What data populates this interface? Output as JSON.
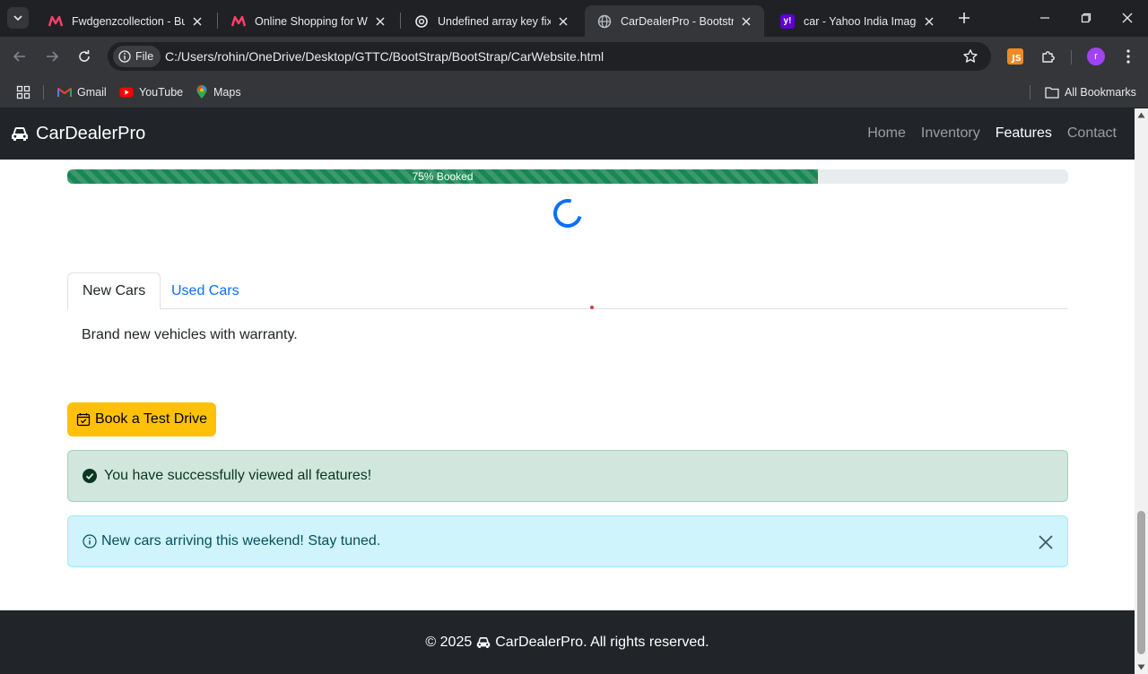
{
  "browser": {
    "tabs": [
      {
        "title": "Fwdgenzcollection - Buy",
        "icon": "myntra-icon"
      },
      {
        "title": "Online Shopping for Wor",
        "icon": "myntra-icon"
      },
      {
        "title": "Undefined array key fix",
        "icon": "chatgpt-icon"
      },
      {
        "title": "CarDealerPro - Bootstrap",
        "icon": "globe-icon",
        "active": true
      },
      {
        "title": "car - Yahoo India Image",
        "icon": "yahoo-icon"
      }
    ],
    "omnibox": {
      "chip_label": "File",
      "url": "C:/Users/rohin/OneDrive/Desktop/GTTC/BootStrap/BootStrap/CarWebsite.html"
    },
    "extension_badge": "JS",
    "avatar_letter": "r",
    "bookmarks": [
      {
        "label": "Gmail",
        "icon": "gmail-icon"
      },
      {
        "label": "YouTube",
        "icon": "youtube-icon"
      },
      {
        "label": "Maps",
        "icon": "maps-icon"
      }
    ],
    "all_bookmarks_label": "All Bookmarks"
  },
  "page": {
    "navbar": {
      "brand": "CarDealerPro",
      "links": [
        {
          "label": "Home"
        },
        {
          "label": "Inventory"
        },
        {
          "label": "Features",
          "active": true
        },
        {
          "label": "Contact"
        }
      ]
    },
    "progress": {
      "label": "75% Booked",
      "value": 0.75
    },
    "tabs": [
      {
        "label": "New Cars",
        "active": true
      },
      {
        "label": "Used Cars"
      }
    ],
    "tab_content": "Brand new vehicles with warranty.",
    "test_drive_button": "Book a Test Drive",
    "alert_success": "You have successfully viewed all features!",
    "alert_info": "New cars arriving this weekend! Stay tuned.",
    "footer": {
      "prefix": "© 2025",
      "suffix": "CarDealerPro. All rights reserved."
    },
    "colors": {
      "navbar_bg": "#212529",
      "progress": "#198754",
      "primary": "#0d6efd",
      "warning": "#ffc107",
      "success_bg": "#d1e7dd",
      "info_bg": "#cff4fc"
    }
  }
}
